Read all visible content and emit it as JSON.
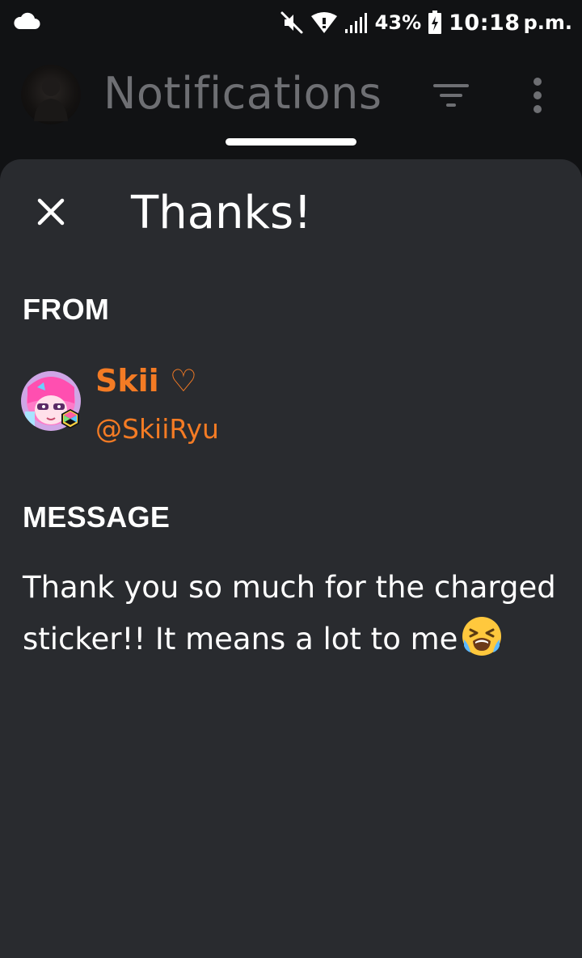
{
  "status_bar": {
    "battery_percent": "43%",
    "time": "10:18",
    "ampm": "p.m.",
    "icons": [
      "cloud-icon",
      "mute-icon",
      "wifi-icon",
      "signal-icon",
      "battery-charging-icon"
    ]
  },
  "header": {
    "title": "Notifications",
    "icons": [
      "avatar",
      "filter-icon",
      "more-vert-icon"
    ]
  },
  "sheet": {
    "title": "Thanks!",
    "from_label": "FROM",
    "sender": {
      "display_name": "Skii ♡",
      "handle": "@SkiiRyu"
    },
    "message_label": "MESSAGE",
    "message_text": "Thank you so much for the charged sticker!! It means a lot to me",
    "message_emoji": "loudly-crying-face-emoji"
  },
  "colors": {
    "sheet_bg": "#292b2f",
    "app_bg": "#111214",
    "accent_orange": "#f47b24",
    "header_title": "#6e6f73"
  }
}
